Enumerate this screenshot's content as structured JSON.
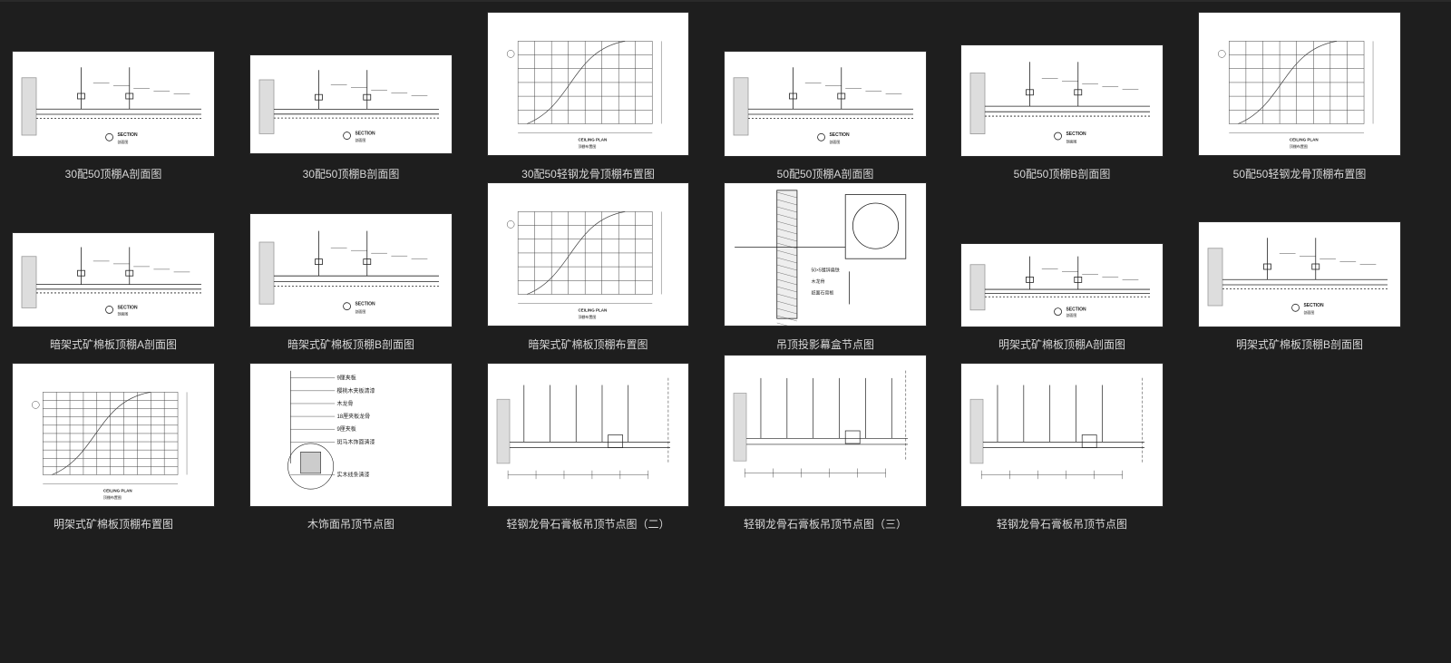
{
  "colors": {
    "background": "#1e1e1e",
    "caption": "#d8d8d8",
    "thumb_bg": "#ffffff",
    "ink": "#222222"
  },
  "items": [
    {
      "caption": "30配50顶棚A剖面图",
      "kind": "section",
      "labels": [
        "SECTION",
        "剖面图"
      ]
    },
    {
      "caption": "30配50顶棚B剖面图",
      "kind": "section",
      "labels": [
        "SECTION",
        "剖面图"
      ]
    },
    {
      "caption": "30配50轻钢龙骨顶棚布置图",
      "kind": "plan",
      "labels": [
        "CEILING PLAN",
        "顶棚布置图"
      ]
    },
    {
      "caption": "50配50顶棚A剖面图",
      "kind": "section",
      "labels": [
        "SECTION",
        "剖面图"
      ]
    },
    {
      "caption": "50配50顶棚B剖面图",
      "kind": "section",
      "labels": [
        "SECTION",
        "剖面图"
      ]
    },
    {
      "caption": "50配50轻钢龙骨顶棚布置图",
      "kind": "plan",
      "labels": [
        "CEILING PLAN",
        "顶棚布置图"
      ]
    },
    {
      "caption": "暗架式矿棉板顶棚A剖面图",
      "kind": "section",
      "labels": [
        "SECTION",
        "剖面图"
      ]
    },
    {
      "caption": "暗架式矿棉板顶棚B剖面图",
      "kind": "section",
      "labels": [
        "SECTION",
        "剖面图"
      ]
    },
    {
      "caption": "暗架式矿棉板顶棚布置图",
      "kind": "plan",
      "labels": [
        "CEILING PLAN",
        "顶棚布置图"
      ]
    },
    {
      "caption": "吊顶投影幕盒节点图",
      "kind": "screenbox",
      "labels": [
        "50×5镀锌扁铁",
        "木龙骨",
        "纸面石膏板"
      ]
    },
    {
      "caption": "明架式矿棉板顶棚A剖面图",
      "kind": "section",
      "labels": [
        "SECTION",
        "剖面图"
      ]
    },
    {
      "caption": "明架式矿棉板顶棚B剖面图",
      "kind": "section",
      "labels": [
        "SECTION",
        "剖面图"
      ]
    },
    {
      "caption": "明架式矿棉板顶棚布置图",
      "kind": "grid",
      "labels": [
        "CEILING PLAN",
        "顶棚布置图"
      ]
    },
    {
      "caption": "木饰面吊顶节点图",
      "kind": "wood",
      "labels": [
        "9厘夹板",
        "樱桃木夹板清漆",
        "木龙骨",
        "18厘夹板龙骨",
        "9厘夹板",
        "斑马木饰面清漆",
        "实木线条清漆"
      ]
    },
    {
      "caption": "轻钢龙骨石膏板吊顶节点图（二）",
      "kind": "node",
      "labels": []
    },
    {
      "caption": "轻钢龙骨石膏板吊顶节点图（三）",
      "kind": "node2",
      "labels": []
    },
    {
      "caption": "轻钢龙骨石膏板吊顶节点图",
      "kind": "node3",
      "labels": []
    }
  ]
}
